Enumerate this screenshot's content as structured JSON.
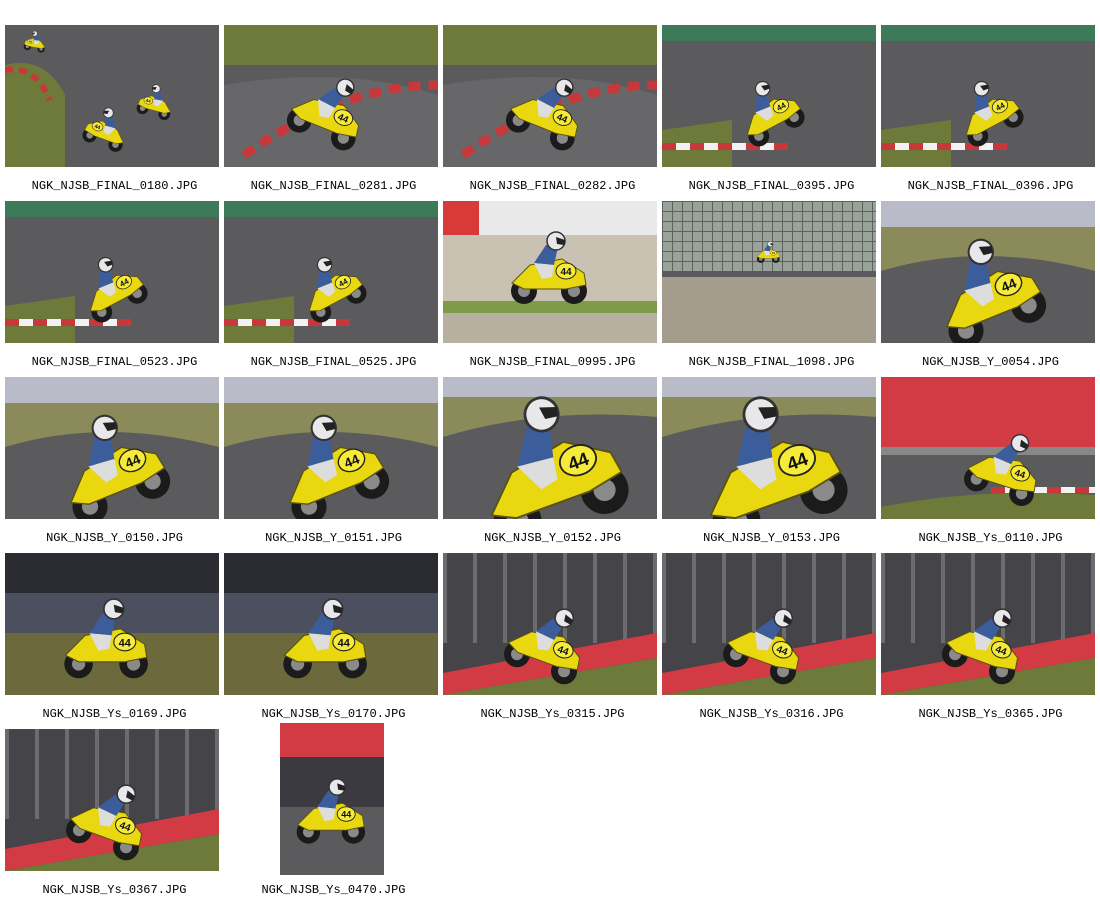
{
  "gallery": {
    "photos": [
      {
        "filename": "NGK_NJSB_FINAL_0180.JPG",
        "scene": "wide-curve"
      },
      {
        "filename": "NGK_NJSB_FINAL_0281.JPG",
        "scene": "lean-right"
      },
      {
        "filename": "NGK_NJSB_FINAL_0282.JPG",
        "scene": "lean-right"
      },
      {
        "filename": "NGK_NJSB_FINAL_0395.JPG",
        "scene": "lean-left-small"
      },
      {
        "filename": "NGK_NJSB_FINAL_0396.JPG",
        "scene": "lean-left-small"
      },
      {
        "filename": "NGK_NJSB_FINAL_0523.JPG",
        "scene": "lean-left-small"
      },
      {
        "filename": "NGK_NJSB_FINAL_0525.JPG",
        "scene": "lean-left-small"
      },
      {
        "filename": "NGK_NJSB_FINAL_0995.JPG",
        "scene": "pit-side"
      },
      {
        "filename": "NGK_NJSB_FINAL_1098.JPG",
        "scene": "fence-distant"
      },
      {
        "filename": "NGK_NJSB_Y_0054.JPG",
        "scene": "lean-left-close"
      },
      {
        "filename": "NGK_NJSB_Y_0150.JPG",
        "scene": "lean-left-close"
      },
      {
        "filename": "NGK_NJSB_Y_0151.JPG",
        "scene": "lean-left-close"
      },
      {
        "filename": "NGK_NJSB_Y_0152.JPG",
        "scene": "lean-left-tight"
      },
      {
        "filename": "NGK_NJSB_Y_0153.JPG",
        "scene": "lean-left-tight"
      },
      {
        "filename": "NGK_NJSB_Ys_0110.JPG",
        "scene": "banner-right"
      },
      {
        "filename": "NGK_NJSB_Ys_0169.JPG",
        "scene": "front-approach"
      },
      {
        "filename": "NGK_NJSB_Ys_0170.JPG",
        "scene": "front-approach"
      },
      {
        "filename": "NGK_NJSB_Ys_0315.JPG",
        "scene": "lean-right-barrier"
      },
      {
        "filename": "NGK_NJSB_Ys_0316.JPG",
        "scene": "lean-right-barrier"
      },
      {
        "filename": "NGK_NJSB_Ys_0365.JPG",
        "scene": "lean-right-barrier"
      },
      {
        "filename": "NGK_NJSB_Ys_0367.JPG",
        "scene": "lean-right-barrier"
      },
      {
        "filename": "NGK_NJSB_Ys_0470.JPG",
        "scene": "portrait-front",
        "orientation": "portrait"
      }
    ],
    "bike_number": "44",
    "colors": {
      "bike_yellow": "#e9d80f",
      "asphalt": "#5b5b5d",
      "grass": "#6e7a3a",
      "kerb_red": "#c8383a",
      "kerb_white": "#f2f2f2",
      "barrier_red": "#d23a44",
      "leathers": "#3c5d9c",
      "helmet": "#e8e8ea"
    }
  }
}
